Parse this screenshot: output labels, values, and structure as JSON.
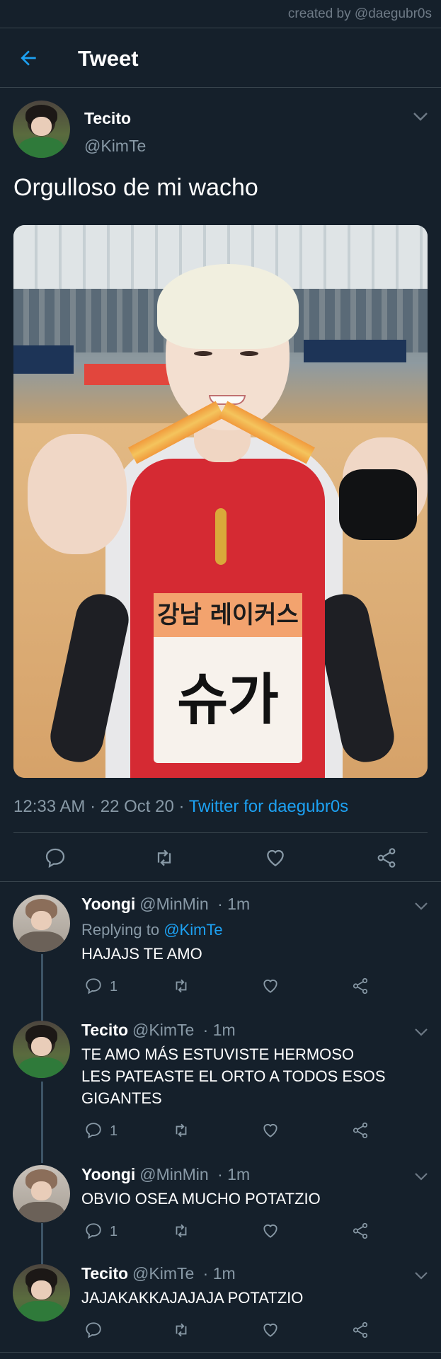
{
  "watermark": "created by @daegubr0s",
  "header": {
    "title": "Tweet"
  },
  "main_tweet": {
    "name": "Tecito",
    "handle": "@KimTe",
    "text": "Orgulloso de mi wacho",
    "photo": {
      "bib_team": "강남 레이커스",
      "bib_name": "슈가"
    },
    "time": "12:33 AM",
    "date": "22 Oct 20",
    "separator": "·",
    "source": "Twitter for daegubr0s"
  },
  "replies": [
    {
      "name": "Yoongi",
      "handle": "@MinMin",
      "time": "· 1m",
      "replying_label": "Replying to",
      "replying_to": "@KimTe",
      "lines": [
        "HAJAJS TE AMO"
      ],
      "reply_count": "1"
    },
    {
      "name": "Tecito",
      "handle": "@KimTe",
      "time": "· 1m",
      "lines": [
        "TE AMO MÁS ESTUVISTE HERMOSO",
        "LES PATEASTE EL ORTO A TODOS ESOS",
        "GIGANTES"
      ],
      "reply_count": "1"
    },
    {
      "name": "Yoongi",
      "handle": "@MinMin",
      "time": "· 1m",
      "lines": [
        "OBVIO OSEA MUCHO POTATZIO"
      ],
      "reply_count": "1"
    },
    {
      "name": "Tecito",
      "handle": "@KimTe",
      "time": "· 1m",
      "lines": [
        "JAJAKAKKAJAJAJA POTATZIO"
      ],
      "reply_count": ""
    }
  ],
  "icons": {
    "back": "arrow-left-icon",
    "reply": "speech-bubble-icon",
    "retweet": "retweet-icon",
    "like": "heart-icon",
    "share": "share-icon",
    "more": "chevron-down-icon"
  },
  "colors": {
    "background": "#15202b",
    "accent": "#1da1f2",
    "muted": "#8899a6",
    "divider": "#38444d"
  }
}
